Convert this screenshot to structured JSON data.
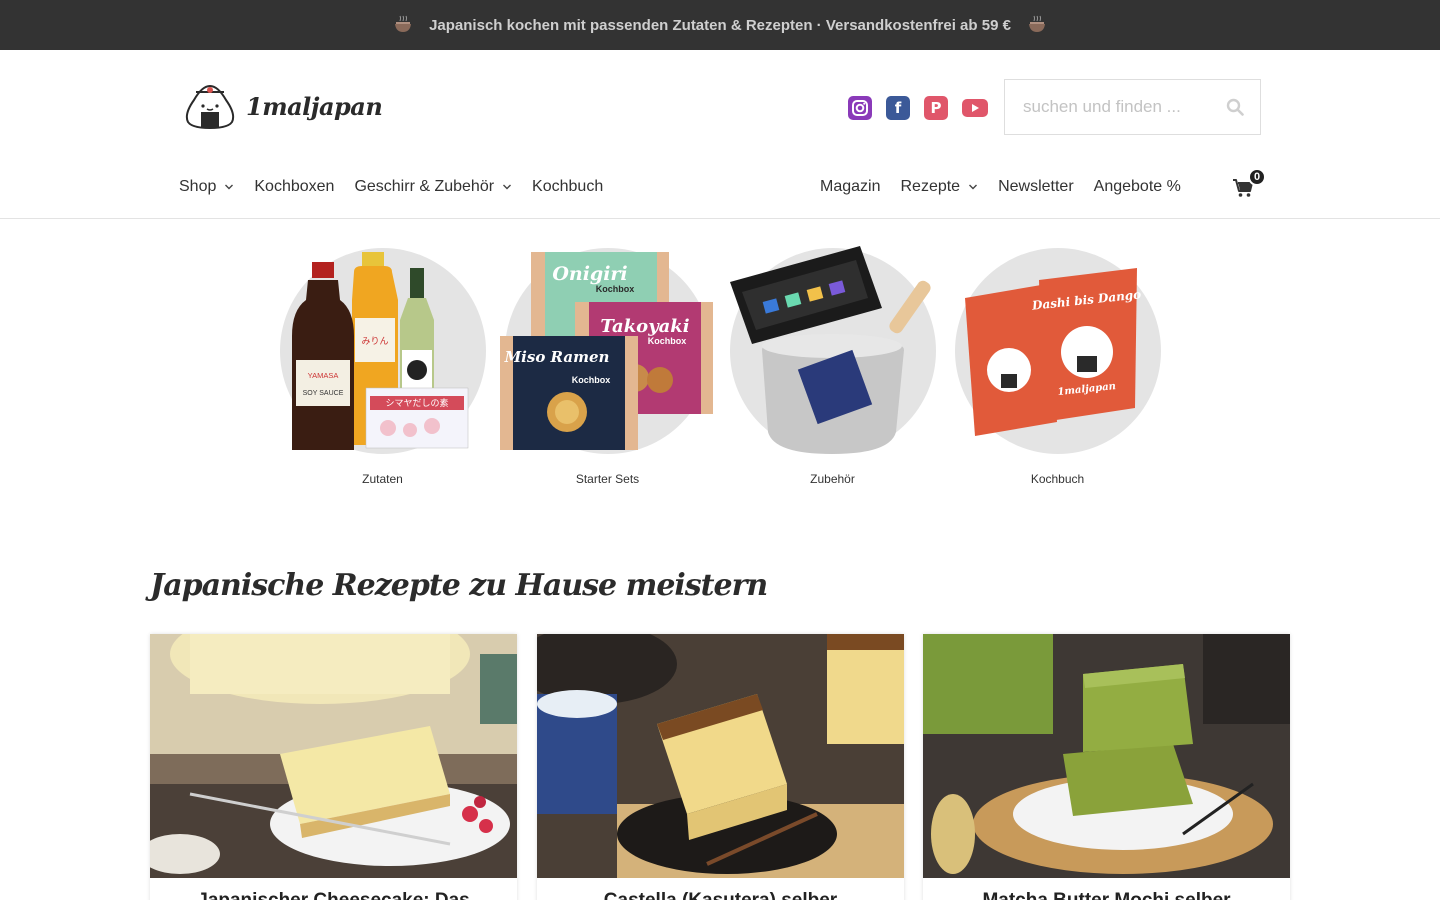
{
  "topbar": {
    "text": "Japanisch kochen mit passenden Zutaten & Rezepten · Versandkostenfrei ab 59 €",
    "background": "#333333"
  },
  "header": {
    "logo_text": "1maljapan",
    "socials": [
      {
        "name": "instagram",
        "color": "#8a3ab9"
      },
      {
        "name": "facebook",
        "color": "#3b5998"
      },
      {
        "name": "pinterest",
        "color": "#e0566a"
      },
      {
        "name": "youtube",
        "color": "#e0566a"
      }
    ],
    "search": {
      "placeholder": "suchen und finden ..."
    }
  },
  "nav": {
    "left": [
      {
        "label": "Shop",
        "has_dropdown": true
      },
      {
        "label": "Kochboxen",
        "has_dropdown": false
      },
      {
        "label": "Geschirr & Zubehör",
        "has_dropdown": true
      },
      {
        "label": "Kochbuch",
        "has_dropdown": false
      }
    ],
    "right": [
      {
        "label": "Magazin",
        "has_dropdown": false
      },
      {
        "label": "Rezepte",
        "has_dropdown": true
      },
      {
        "label": "Newsletter",
        "has_dropdown": false
      },
      {
        "label": "Angebote %",
        "has_dropdown": false
      }
    ],
    "cart_count": "0"
  },
  "categories": [
    {
      "label": "Zutaten"
    },
    {
      "label": "Starter Sets"
    },
    {
      "label": "Zubehör"
    },
    {
      "label": "Kochbuch"
    }
  ],
  "category_art": {
    "soy_label": "YAMASA",
    "soy_sub": "SOY SAUCE",
    "kit1": "Onigiri",
    "kit1_sub": "Kochbox",
    "kit2": "Takoyaki",
    "kit2_sub": "Kochbox",
    "kit3": "Miso Ramen",
    "kit3_sub": "Kochbox",
    "book_title": "Dashi bis Dango",
    "book_brand": "1maljapan"
  },
  "recipes": {
    "section_title": "Japanische Rezepte zu Hause meistern",
    "cards": [
      {
        "title": "Japanischer Cheesecake: Das"
      },
      {
        "title": "Castella (Kasutera) selber"
      },
      {
        "title": "Matcha Butter Mochi selber"
      }
    ]
  }
}
